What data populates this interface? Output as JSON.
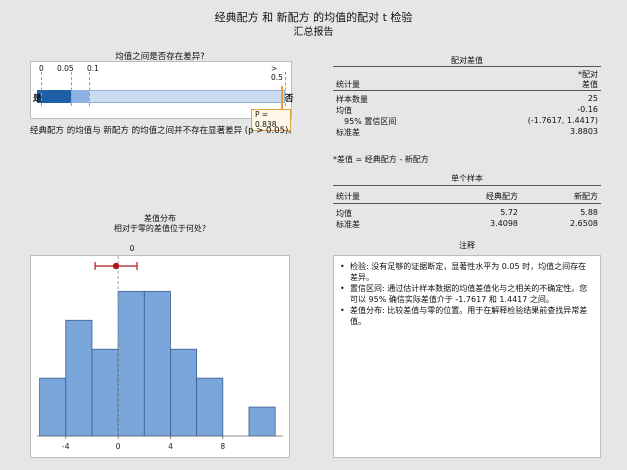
{
  "header": {
    "title": "经典配方 和 新配方 的均值的配对 t 检验",
    "subtitle": "汇总报告"
  },
  "question": {
    "title": "均值之间是否存在差异?",
    "ticks": [
      "0",
      "0.05",
      "0.1",
      "> 0.5"
    ],
    "yes_label": "是",
    "no_label": "否",
    "p_label": "P = 0.838",
    "p_value": 0.838,
    "conclusion": "经典配方 的均值与 新配方 的均值之间并不存在显著差异 (p > 0.05)。"
  },
  "paired_diff": {
    "title": "配对差值",
    "col_header_top": "*配对",
    "col_header_bottom": "差值",
    "stat_header": "统计量",
    "rows": [
      {
        "label": "样本数量",
        "value": "25"
      },
      {
        "label": "均值",
        "value": "-0.16"
      },
      {
        "label": "95% 置信区间",
        "value": "(-1.7617, 1.4417)"
      },
      {
        "label": "标准差",
        "value": "3.8803"
      }
    ],
    "footnote": "*差值 = 经典配方 - 新配方"
  },
  "single_sample": {
    "title": "单个样本",
    "stat_header": "统计量",
    "col1": "经典配方",
    "col2": "新配方",
    "rows": [
      {
        "label": "均值",
        "v1": "5.72",
        "v2": "5.88"
      },
      {
        "label": "标准差",
        "v1": "3.4098",
        "v2": "2.6508"
      }
    ]
  },
  "distribution": {
    "title": "差值分布",
    "subtitle": "相对于零的差值位于何处?",
    "zero_label": "0"
  },
  "chart_data": {
    "type": "bar",
    "title": "差值分布",
    "subtitle": "相对于零的差值位于何处?",
    "bin_width": 2,
    "bin_edges": [
      -6,
      -4,
      -2,
      0,
      2,
      4,
      6,
      8,
      10,
      12
    ],
    "counts": [
      2,
      4,
      3,
      5,
      5,
      3,
      2,
      0,
      1
    ],
    "x_ticks": [
      -4,
      0,
      4,
      8
    ],
    "x_tick_labels": [
      "-4",
      "0",
      "4",
      "8"
    ],
    "xlim": [
      -6.2,
      12.6
    ],
    "ylim": [
      0,
      5.6
    ],
    "mean": -0.16,
    "ci": [
      -1.7617,
      1.4417
    ],
    "reference": 0,
    "colors": {
      "bar": "#7aa6dc",
      "bar_edge": "#3c5f8c",
      "ci": "#b01818"
    }
  },
  "notes": {
    "title": "注释",
    "items": [
      "检验: 没有足够的证据断定，显著性水平为 0.05 时，均值之间存在差异。",
      "置信区间: 通过估计样本数据的均值差值化与之相关的不确定性。您可以 95% 确信实际差值介于 -1.7617 和 1.4417 之间。",
      "差值分布: 比较差值与零的位置。用于在解释检验结果前查找异常差值。"
    ]
  }
}
